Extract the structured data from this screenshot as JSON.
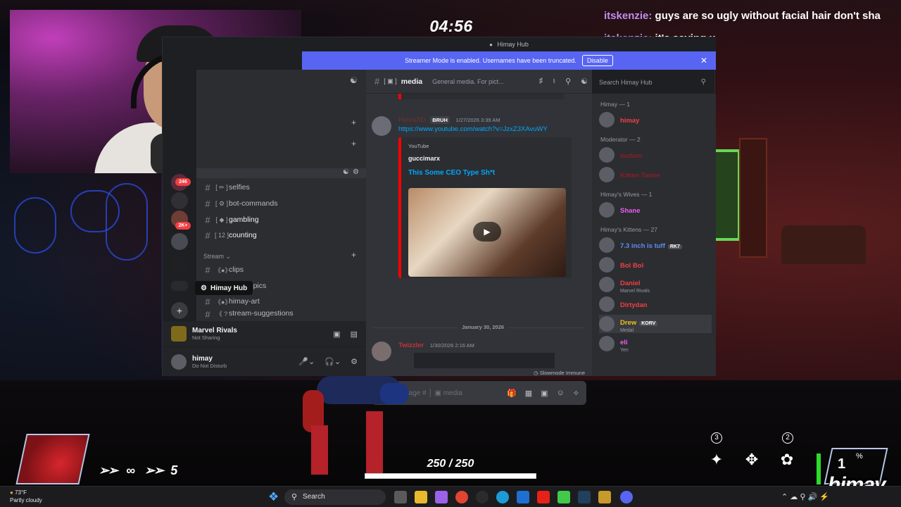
{
  "stream": {
    "timer": "04:56",
    "chat": [
      {
        "user": "itskenzie:",
        "text": "guys are so ugly without facial hair don't sha"
      },
      {
        "user": "itskenzie:",
        "text": "it's saving u"
      }
    ]
  },
  "discord": {
    "window_title": "Himay Hub",
    "streamer_banner": {
      "text": "Streamer Mode is enabled. Usernames have been truncated.",
      "button": "Disable"
    },
    "servers": [
      {
        "icon": "server-icon",
        "badge": "246"
      },
      {
        "icon": "server-icon",
        "badge": ""
      },
      {
        "icon": "server-icon",
        "badge": "2K+"
      },
      {
        "icon": "server-icon",
        "badge": ""
      },
      {
        "icon": "server-icon",
        "badge": ""
      },
      {
        "icon": "server-icon",
        "badge": ""
      }
    ],
    "tooltip": "Himay Hub",
    "channels": [
      {
        "emoji": "[ ✏ ]",
        "name": "selfies",
        "unread": false
      },
      {
        "emoji": "[ ⚙ ]",
        "name": "bot-commands",
        "unread": false
      },
      {
        "emoji": "[ ◆ ]",
        "name": "gambling",
        "unread": true
      },
      {
        "emoji": "[ 12 ]",
        "name": "counting",
        "unread": true
      }
    ],
    "category_stream": "Stream",
    "stream_channels": [
      {
        "emoji": "《●》",
        "name": "clips"
      },
      {
        "emoji": "",
        "name": "ay-pics"
      },
      {
        "emoji": "《●》",
        "name": "himay-art"
      },
      {
        "emoji": "《 ? 》",
        "name": "stream-suggestions"
      }
    ],
    "voice": {
      "title": "Marvel Rivals",
      "subtitle": "Not Sharing"
    },
    "user": {
      "name": "himay",
      "status": "Do Not Disturb"
    },
    "main": {
      "channel_emoji": "[ ▣ ]",
      "channel": "media",
      "topic": "General media. For pict...",
      "search_placeholder": "Search Himay Hub",
      "messages": [
        {
          "user": "HelvaXD",
          "tag": "BRUH",
          "time": "1/27/2026 3:39 AM",
          "link": "https://www.youtube.com/watch?v=JzxZ3XAvuWY",
          "embed": {
            "provider": "YouTube",
            "author": "guccimarx",
            "title": "This Some CEO Type Sh*t"
          }
        },
        {
          "user": "Twizzler",
          "time": "1/30/2026 2:16 AM"
        }
      ],
      "date_divider": "January 30, 2026",
      "slowmode": "Slowmode Immune",
      "composer_placeholder": "Message # │ ▣ media"
    },
    "members": {
      "groups": [
        {
          "label": "Himay — 1",
          "items": [
            {
              "name": "himay",
              "sub": "",
              "tag": "",
              "color": "#f23f43"
            }
          ]
        },
        {
          "label": "Moderator — 2",
          "items": [
            {
              "name": "audum",
              "sub": "",
              "tag": "",
              "color": "#8b1f25"
            },
            {
              "name": "Kitten Tamer",
              "sub": "",
              "tag": "",
              "color": "#8b1f25"
            }
          ]
        },
        {
          "label": "Himay's Wives — 1",
          "items": [
            {
              "name": "Shane",
              "sub": "",
              "tag": "",
              "color": "#ec5df2"
            }
          ]
        },
        {
          "label": "Himay's Kittens — 27",
          "items": [
            {
              "name": "7.3 inch is tuff",
              "sub": "",
              "tag": "RK7",
              "color": "#5d8cf2"
            },
            {
              "name": "Bol Bol",
              "sub": "",
              "tag": "",
              "color": "#f23f43"
            },
            {
              "name": "Daniel",
              "sub": "Marvel Rivals",
              "tag": "",
              "color": "#f23f43"
            },
            {
              "name": "Dirtydan",
              "sub": "",
              "tag": "",
              "color": "#f23f43"
            },
            {
              "name": "Drew",
              "sub": "Medal",
              "tag": "KORV",
              "color": "#f0c419"
            },
            {
              "name": "eli",
              "sub": "Yen",
              "tag": "",
              "color": "#ec5df2"
            }
          ]
        }
      ]
    }
  },
  "hud": {
    "ammo": "5",
    "infinity": "∞",
    "health": "250 / 250",
    "health_fraction": 1.0,
    "ability_keys": [
      "3",
      "2"
    ],
    "ult_count": "1",
    "ult_pct": "%",
    "streamer_logo": "himay"
  },
  "taskbar": {
    "temp": "73°F",
    "weather": "Partly cloudy",
    "search": "Search"
  }
}
